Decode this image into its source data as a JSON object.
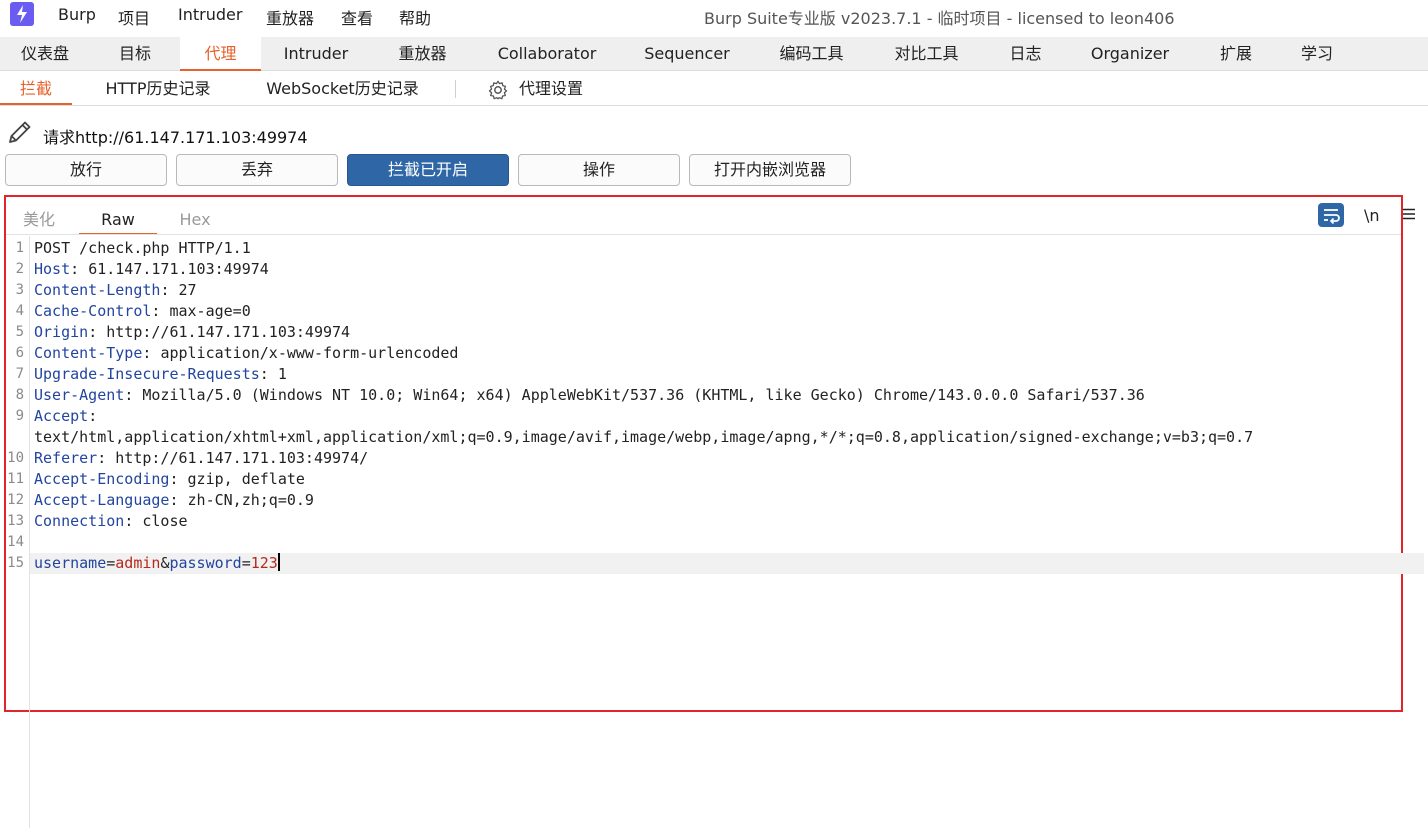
{
  "menubar": {
    "items": [
      "Burp",
      "项目",
      "Intruder",
      "重放器",
      "查看",
      "帮助"
    ],
    "window_title": "Burp Suite专业版  v2023.7.1 - 临时项目 - licensed to leon406"
  },
  "main_tabs": [
    "仪表盘",
    "目标",
    "代理",
    "Intruder",
    "重放器",
    "Collaborator",
    "Sequencer",
    "编码工具",
    "对比工具",
    "日志",
    "Organizer",
    "扩展",
    "学习"
  ],
  "main_tab_active": "代理",
  "sub_tabs": [
    "拦截",
    "HTTP历史记录",
    "WebSocket历史记录"
  ],
  "sub_tab_active": "拦截",
  "proxy_settings_label": "代理设置",
  "request_label": "请求http://61.147.171.103:49974",
  "buttons": [
    "放行",
    "丢弃",
    "拦截已开启",
    "操作",
    "打开内嵌浏览器"
  ],
  "intercept_on": true,
  "editor": {
    "tabs": [
      "美化",
      "Raw",
      "Hex"
    ],
    "active_tab": "Raw",
    "newline_toggle": "\\n",
    "line_numbers": [
      "1",
      "2",
      "3",
      "4",
      "5",
      "6",
      "7",
      "8",
      "9",
      "",
      "10",
      "11",
      "12",
      "13",
      "14",
      "15"
    ],
    "request_line": "POST /check.php HTTP/1.1",
    "headers": [
      {
        "name": "Host",
        "value": "61.147.171.103:49974"
      },
      {
        "name": "Content-Length",
        "value": "27"
      },
      {
        "name": "Cache-Control",
        "value": "max-age=0"
      },
      {
        "name": "Origin",
        "value": "http://61.147.171.103:49974"
      },
      {
        "name": "Content-Type",
        "value": "application/x-www-form-urlencoded"
      },
      {
        "name": "Upgrade-Insecure-Requests",
        "value": "1"
      },
      {
        "name": "User-Agent",
        "value": "Mozilla/5.0 (Windows NT 10.0; Win64; x64) AppleWebKit/537.36 (KHTML, like Gecko) Chrome/143.0.0.0 Safari/537.36"
      },
      {
        "name": "Accept",
        "value": ""
      },
      {
        "name": "",
        "value": "text/html,application/xhtml+xml,application/xml;q=0.9,image/avif,image/webp,image/apng,*/*;q=0.8,application/signed-exchange;v=b3;q=0.7"
      },
      {
        "name": "Referer",
        "value": "http://61.147.171.103:49974/"
      },
      {
        "name": "Accept-Encoding",
        "value": "gzip, deflate"
      },
      {
        "name": "Accept-Language",
        "value": "zh-CN,zh;q=0.9"
      },
      {
        "name": "Connection",
        "value": "close"
      }
    ],
    "body": [
      {
        "name": "username",
        "value": "admin"
      },
      {
        "name": "password",
        "value": "123"
      }
    ]
  },
  "colors": {
    "accent": "#e8612c",
    "intercept_button": "#2f67a6",
    "highlight_border": "#e0262b",
    "header_key": "#2345a0",
    "param_value": "#b8281e"
  }
}
